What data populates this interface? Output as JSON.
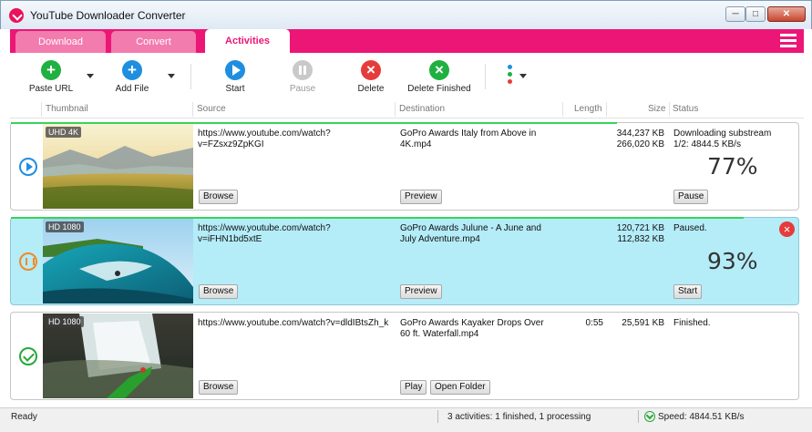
{
  "window": {
    "title": "YouTube Downloader Converter",
    "min": "─",
    "max": "□",
    "close": "✕"
  },
  "tabs": [
    {
      "label": "Download"
    },
    {
      "label": "Convert"
    },
    {
      "label": "Activities"
    }
  ],
  "toolbar": {
    "paste_url": "Paste URL",
    "add_file": "Add File",
    "start": "Start",
    "pause": "Pause",
    "delete": "Delete",
    "delete_finished": "Delete Finished"
  },
  "columns": {
    "thumbnail": "Thumbnail",
    "source": "Source",
    "destination": "Destination",
    "length": "Length",
    "size": "Size",
    "status": "Status"
  },
  "rows": [
    {
      "badge": "UHD 4K",
      "source": "https://www.youtube.com/watch?v=FZsxz9ZpKGI",
      "destination": "GoPro Awards  Italy from Above in 4K.mp4",
      "length": "",
      "size1": "344,237 KB",
      "size2": "266,020 KB",
      "status": "Downloading substream 1/2: 4844.5 KB/s",
      "percent": "77%",
      "progress": 0.77,
      "browse": "Browse",
      "action1": "Preview",
      "action2": "Pause"
    },
    {
      "badge": "HD 1080",
      "source": "https://www.youtube.com/watch?v=iFHN1bd5xtE",
      "destination": "GoPro Awards  Julune - A June and July Adventure.mp4",
      "length": "",
      "size1": "120,721 KB",
      "size2": "112,832 KB",
      "status": "Paused.",
      "percent": "93%",
      "progress": 0.93,
      "browse": "Browse",
      "action1": "Preview",
      "action2": "Start"
    },
    {
      "badge": "HD 1080",
      "source": "https://www.youtube.com/watch?v=dldIBtsZh_k",
      "destination": "GoPro Awards  Kayaker Drops Over 60 ft. Waterfall.mp4",
      "length": "0:55",
      "size1": "25,591 KB",
      "size2": "",
      "status": "Finished.",
      "percent": "",
      "browse": "Browse",
      "action1": "Play",
      "action2": "Open Folder"
    }
  ],
  "statusbar": {
    "ready": "Ready",
    "summary": "3 activities: 1 finished, 1 processing",
    "speed": "Speed: 4844.51 KB/s"
  },
  "colors": {
    "accent": "#ec1676",
    "selected_row": "#b4ecf8",
    "progress": "#39d35a"
  },
  "icons": [
    "app-logo-icon",
    "plus-icon",
    "play-icon",
    "pause-icon",
    "close-icon",
    "check-icon",
    "more-icon",
    "menu-icon",
    "download-arrow-icon"
  ]
}
